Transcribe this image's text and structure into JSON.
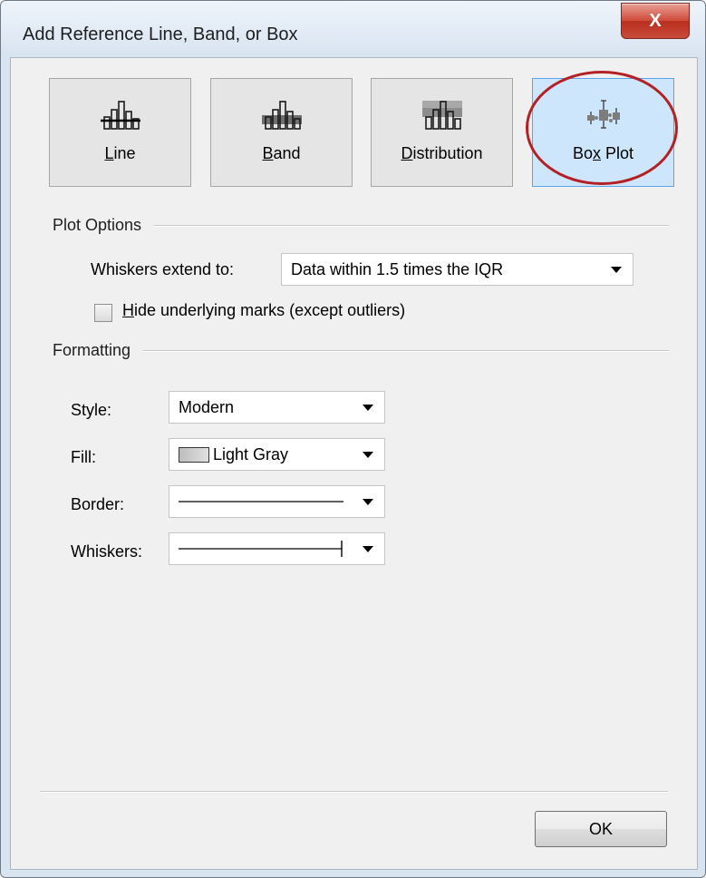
{
  "window": {
    "title": "Add Reference Line, Band, or Box",
    "close_glyph": "X"
  },
  "types": [
    {
      "label": "Line",
      "mnemonic": "L",
      "rest": "ine",
      "icon": "line-chart-icon",
      "selected": false
    },
    {
      "label": "Band",
      "mnemonic": "B",
      "rest": "and",
      "icon": "band-chart-icon",
      "selected": false
    },
    {
      "label": "Distribution",
      "mnemonic": "D",
      "rest": "istribution",
      "icon": "distribution-chart-icon",
      "selected": false
    },
    {
      "label": "Box Plot",
      "pre": "Bo",
      "mnemonic": "x",
      "rest": " Plot",
      "icon": "box-plot-icon",
      "selected": true
    }
  ],
  "plot_options": {
    "heading": "Plot Options",
    "whiskers_label": "Whiskers extend to:",
    "whiskers_value": "Data within 1.5 times the IQR",
    "hide_marks": {
      "mnemonic": "H",
      "rest": "ide underlying marks (except outliers)",
      "checked": false
    }
  },
  "formatting": {
    "heading": "Formatting",
    "style_label": "Style:",
    "style_value": "Modern",
    "fill_label": "Fill:",
    "fill_value": "Light Gray",
    "border_label": "Border:",
    "whiskers_label": "Whiskers:"
  },
  "ok_label": "OK",
  "colors": {
    "selected_bg": "#cde6fb",
    "annotation_circle": "#b52025",
    "close_button": "#c94b3b"
  }
}
